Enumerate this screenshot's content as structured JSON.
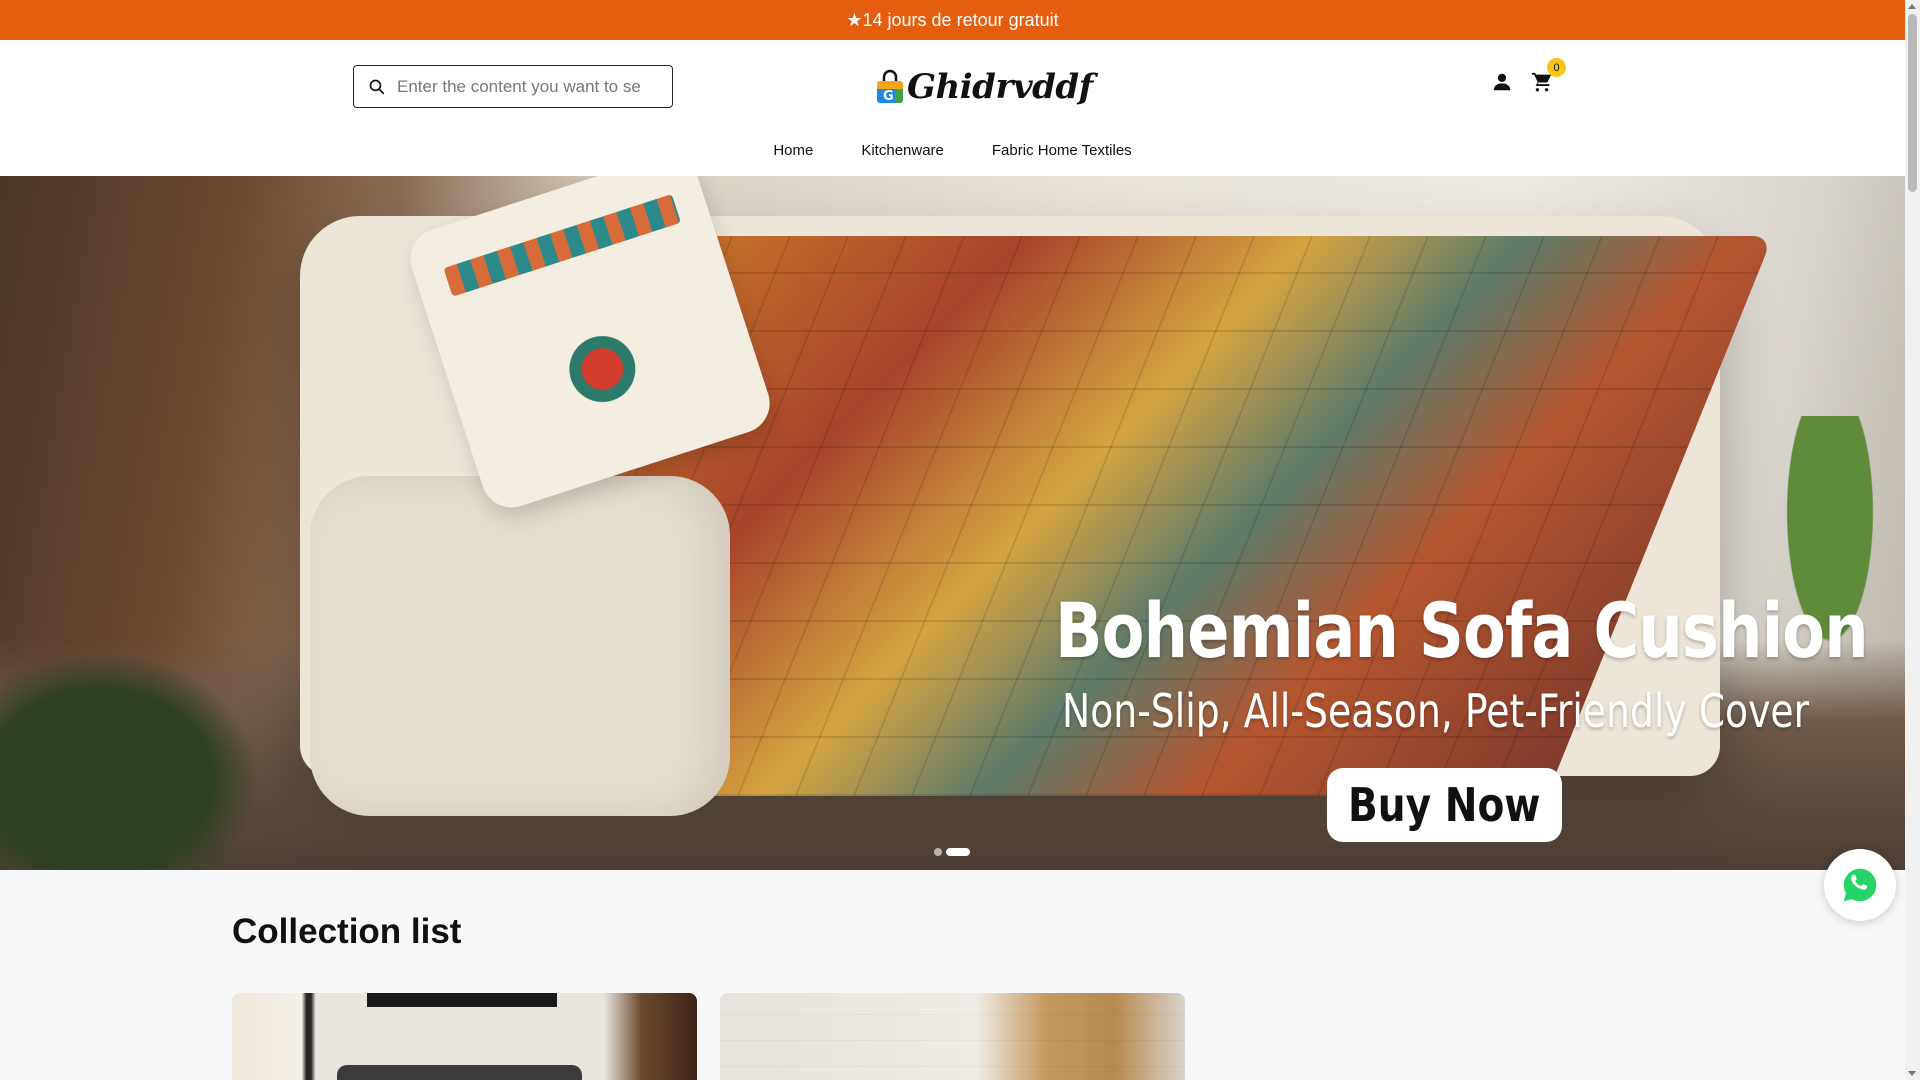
{
  "announcement": {
    "text": "★14 jours de retour gratuit"
  },
  "header": {
    "search": {
      "placeholder": "Enter the content you want to se"
    },
    "logo": {
      "text": "Ghidrvddf"
    },
    "cart": {
      "count": "0"
    }
  },
  "nav": {
    "items": [
      {
        "label": "Home"
      },
      {
        "label": "Kitchenware"
      },
      {
        "label": "Fabric Home Textiles"
      }
    ]
  },
  "hero": {
    "title": "Bohemian Sofa Cushion",
    "subtitle": "Non-Slip, All-Season, Pet-Friendly Cover",
    "cta": "Buy Now",
    "slide_count": 2,
    "active_slide": 2
  },
  "collection": {
    "title": "Collection list"
  },
  "colors": {
    "announcement_bg": "#e55e10",
    "cart_badge": "#f5c518",
    "whatsapp": "#25d366"
  },
  "icons": {
    "search": "search-icon",
    "account": "user-icon",
    "cart": "cart-icon",
    "whatsapp": "whatsapp-icon"
  }
}
